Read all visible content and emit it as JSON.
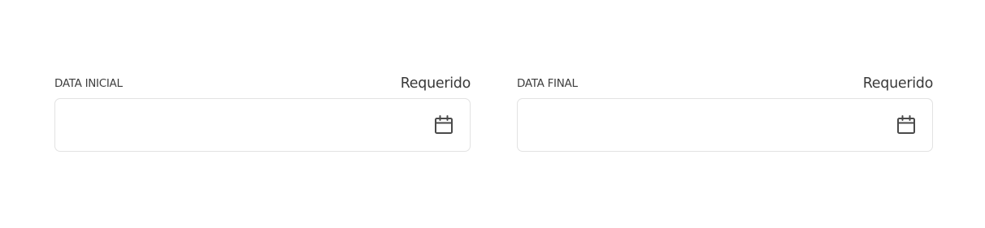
{
  "date_filters": {
    "start_date": {
      "label": "DATA INICIAL",
      "required_text": "Requerido",
      "value": "",
      "icon": "calendar-icon"
    },
    "end_date": {
      "label": "DATA FINAL",
      "required_text": "Requerido",
      "value": "",
      "icon": "calendar-icon"
    }
  },
  "colors": {
    "label_text": "#3f3f3f",
    "border": "#e2e2e2",
    "icon": "#4a4a4a",
    "background": "#ffffff"
  }
}
